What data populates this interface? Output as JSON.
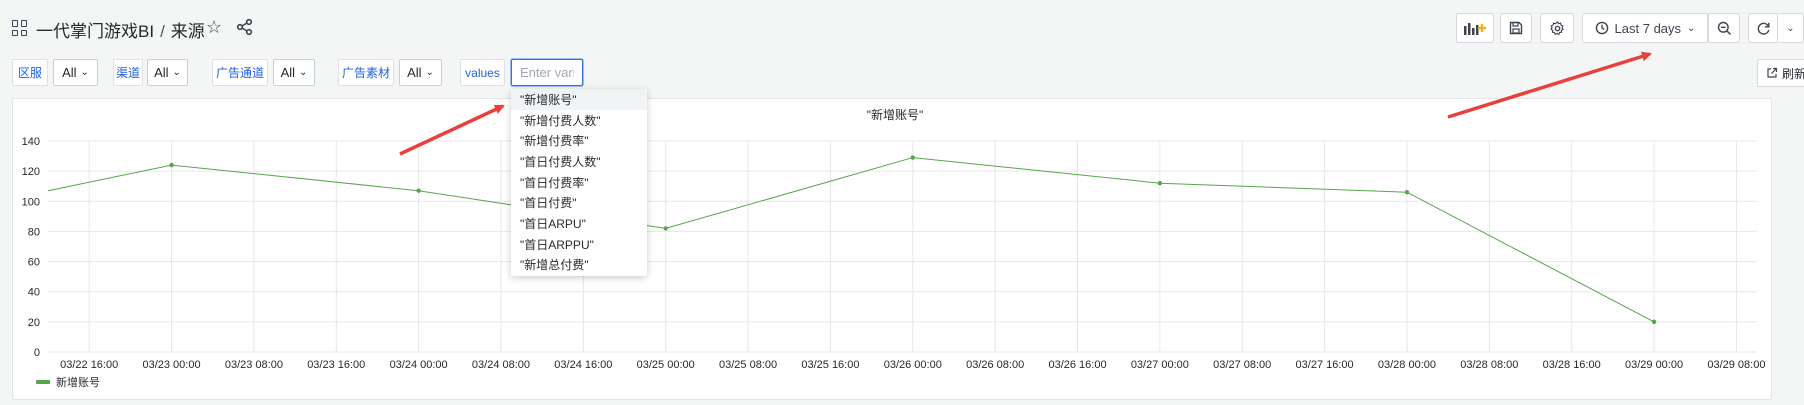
{
  "header": {
    "title": "一代掌门游戏BI",
    "separator": "/",
    "subtitle": "来源",
    "time_range": "Last 7 days"
  },
  "variables": [
    {
      "label": "区服",
      "value": "All"
    },
    {
      "label": "渠道",
      "value": "All"
    },
    {
      "label": "广告通道",
      "value": "All"
    },
    {
      "label": "广告素材",
      "value": "All"
    }
  ],
  "values_var": {
    "label": "values",
    "placeholder": "Enter variable value"
  },
  "refresh_link_label": "刷新",
  "dropdown": {
    "items": [
      "\"新增账号\"",
      "\"新增付费人数\"",
      "\"新增付费率\"",
      "\"首日付费人数\"",
      "\"首日付费率\"",
      "\"首日付费\"",
      "\"首日ARPU\"",
      "\"首日ARPPU\"",
      "\"新增总付费\""
    ]
  },
  "colors": {
    "series": "#56a64b",
    "accent": "#1f62e0",
    "annotation_arrow": "#e8403d"
  },
  "chart_data": {
    "type": "line",
    "title": "\"新增账号\"",
    "xlabel": "",
    "ylabel": "",
    "ylim": [
      0,
      140
    ],
    "yticks": [
      0,
      20,
      40,
      60,
      80,
      100,
      120,
      140
    ],
    "xlim": [
      "03/22 12:00",
      "03/29 10:00"
    ],
    "xticks": [
      "03/22 16:00",
      "03/23 00:00",
      "03/23 08:00",
      "03/23 16:00",
      "03/24 00:00",
      "03/24 08:00",
      "03/24 16:00",
      "03/25 00:00",
      "03/25 08:00",
      "03/25 16:00",
      "03/26 00:00",
      "03/26 08:00",
      "03/26 16:00",
      "03/27 00:00",
      "03/27 08:00",
      "03/27 16:00",
      "03/28 00:00",
      "03/28 08:00",
      "03/28 16:00",
      "03/29 00:00",
      "03/29 08:00"
    ],
    "grid": true,
    "legend_position": "bottom-left",
    "series": [
      {
        "name": "新增账号",
        "x": [
          "03/22 12:00",
          "03/23 00:00",
          "03/24 00:00",
          "03/25 00:00",
          "03/26 00:00",
          "03/27 00:00",
          "03/28 00:00",
          "03/29 00:00"
        ],
        "values": [
          107,
          124,
          107,
          82,
          129,
          112,
          106,
          20
        ]
      }
    ]
  }
}
